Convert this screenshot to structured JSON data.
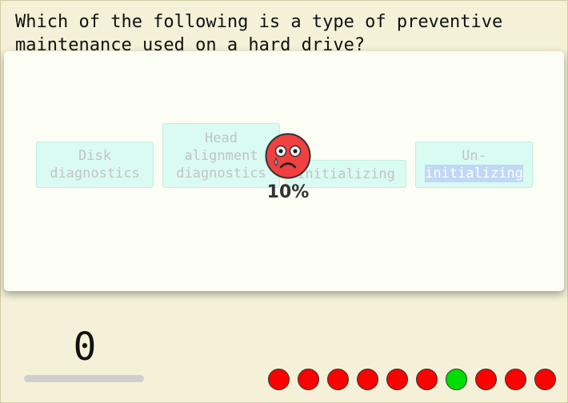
{
  "question": {
    "text": "Which of the following is a type of preventive maintenance used on a hard drive?"
  },
  "answers": [
    {
      "lines": [
        "Disk",
        "diagnostics"
      ]
    },
    {
      "lines": [
        "Head",
        "alignment",
        "diagnostics"
      ]
    },
    {
      "lines": [
        "Initializing"
      ]
    },
    {
      "lines": [
        "Un-",
        "initializing"
      ]
    }
  ],
  "result": {
    "face": "sad-crying-face-icon",
    "percent_label": "10%"
  },
  "score": {
    "value": "0",
    "progress_fraction": 0
  },
  "history": {
    "dot_states": [
      "wrong",
      "wrong",
      "wrong",
      "wrong",
      "wrong",
      "wrong",
      "correct",
      "wrong",
      "wrong",
      "wrong"
    ]
  },
  "colors": {
    "background": "#f4f1d8",
    "card": "#fcfdf5",
    "answer_bg": "#d9fbf1",
    "answer_text": "#c3c3c3",
    "wrong": "#ff0000",
    "correct": "#00dd00",
    "face": "#f04040"
  }
}
